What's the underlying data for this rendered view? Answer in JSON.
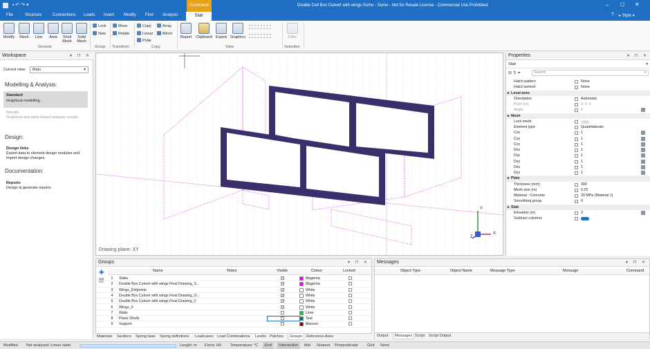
{
  "window": {
    "title": "Double Cell Box Culvert with wings.Sumo - Sumo - Not for Resale License - Commercial Use Prohibited",
    "context_tab": "Command",
    "style_label": "Style"
  },
  "menu": [
    "File",
    "Structure",
    "Connections",
    "Loads",
    "Insert",
    "Modify",
    "Find",
    "Analysis",
    "Slab"
  ],
  "ribbon": {
    "general": {
      "label": "General",
      "buttons": [
        "Modify",
        "Mesh",
        "Line",
        "Area",
        "Shell Mesh",
        "Solid Mesh"
      ]
    },
    "group": {
      "label": "Group",
      "buttons": [
        "Lock",
        "New"
      ]
    },
    "transform": {
      "label": "Transform",
      "buttons": [
        "Move",
        "Rotate"
      ]
    },
    "copy": {
      "label": "Copy",
      "buttons": [
        "Copy",
        "Array",
        "Linear",
        "Mirror",
        "Polar"
      ]
    },
    "view": {
      "label": "View",
      "buttons": [
        "Report",
        "Clipboard",
        "Export",
        "Graphics"
      ]
    },
    "selection": {
      "label": "Selection",
      "buttons": [
        "Filter"
      ]
    }
  },
  "workspace": {
    "title": "Workspace",
    "current_view_label": "Current view:",
    "current_view": "Main",
    "sections": [
      {
        "heading": "Modelling & Analysis:",
        "items": [
          {
            "title": "Standard",
            "desc": "Graphical modelling."
          },
          {
            "title": "Results",
            "desc": "Graphical and table-based analysis results."
          }
        ]
      },
      {
        "heading": "Design:",
        "items": [
          {
            "title": "Design links",
            "desc": "Export data to element design modules and import design changes."
          }
        ]
      },
      {
        "heading": "Documentation:",
        "items": [
          {
            "title": "Reports",
            "desc": "Design & generate reports."
          }
        ]
      }
    ]
  },
  "view": {
    "drawing_plane": "Drawing plane: XY",
    "axes": [
      "X",
      "Y",
      "Z"
    ]
  },
  "properties": {
    "title": "Properties",
    "selection": "Slab",
    "search_placeholder": "Search",
    "rows": [
      {
        "type": "row",
        "name": "Hatch pattern",
        "value": "None"
      },
      {
        "type": "row",
        "name": "Hatch behind",
        "value": "None"
      },
      {
        "type": "section",
        "name": "Local axes"
      },
      {
        "type": "row",
        "name": "Orientation",
        "value": "Automatic"
      },
      {
        "type": "row",
        "name": "Point (m)",
        "value": "0, 0, 0"
      },
      {
        "type": "row",
        "name": "Angle",
        "value": "0",
        "edit": true
      },
      {
        "type": "section",
        "name": "Mesh"
      },
      {
        "type": "row",
        "name": "Lock mesh",
        "value": ""
      },
      {
        "type": "row",
        "name": "Element type",
        "value": "Quadrilaterals"
      },
      {
        "type": "row",
        "name": "Cxx",
        "value": "1",
        "edit": true
      },
      {
        "type": "row",
        "name": "Cyy",
        "value": "1",
        "edit": true
      },
      {
        "type": "row",
        "name": "Cxy",
        "value": "1",
        "edit": true
      },
      {
        "type": "row",
        "name": "Dxx",
        "value": "1",
        "edit": true
      },
      {
        "type": "row",
        "name": "Dyy",
        "value": "1",
        "edit": true
      },
      {
        "type": "row",
        "name": "Dxy",
        "value": "1",
        "edit": true
      },
      {
        "type": "row",
        "name": "Dxz",
        "value": "1",
        "edit": true
      },
      {
        "type": "row",
        "name": "Dyz",
        "value": "1",
        "edit": true
      },
      {
        "type": "section",
        "name": "Plate"
      },
      {
        "type": "row",
        "name": "Thickness (mm)",
        "value": "300"
      },
      {
        "type": "row",
        "name": "Mesh size (m)",
        "value": "0.25"
      },
      {
        "type": "row",
        "name": "Material - Concrete",
        "value": "30 MPa (Material 1)"
      },
      {
        "type": "row",
        "name": "Smoothing group",
        "value": "0"
      },
      {
        "type": "section",
        "name": "Slab"
      },
      {
        "type": "row",
        "name": "Elevation (m)",
        "value": "3",
        "edit": true
      },
      {
        "type": "row",
        "name": "Subtract columns",
        "value": ""
      }
    ]
  },
  "groups": {
    "title": "Groups",
    "columns": [
      "Name",
      "Notes",
      "Visible",
      "Colour",
      "Locked"
    ],
    "rows": [
      {
        "num": "1",
        "name": "Slabs",
        "visible": true,
        "color_hex": "#d41cd4",
        "color": "Magenta"
      },
      {
        "num": "2",
        "name": "Double Box Culvert with wings Final Drawing_S...",
        "visible": true,
        "color_hex": "#d41cd4",
        "color": "Magenta"
      },
      {
        "num": "3",
        "name": "Wings_Dxfpoints",
        "visible": true,
        "color_hex": "#ffffff",
        "color": "White"
      },
      {
        "num": "4",
        "name": "Double Box Culvert with wings Final Drawing_O...",
        "visible": true,
        "color_hex": "#ffffff",
        "color": "White"
      },
      {
        "num": "5",
        "name": "Double Box Culvert with wings Final Drawing_0",
        "visible": true,
        "color_hex": "#ffffff",
        "color": "White"
      },
      {
        "num": "6",
        "name": "Wings_0",
        "visible": true,
        "color_hex": "#ffffff",
        "color": "White"
      },
      {
        "num": "7",
        "name": "Walls",
        "visible": false,
        "color_hex": "#22cc22",
        "color": "Lime"
      },
      {
        "num": "8",
        "name": "Plane Shells",
        "visible": false,
        "color_hex": "#0f6d6d",
        "color": "Teal"
      },
      {
        "num": "9",
        "name": "Support",
        "visible": false,
        "color_hex": "#7a0000",
        "color": "Maroon"
      }
    ]
  },
  "bottom_tabs": [
    "Materials",
    "Sections",
    "Spring laws",
    "Spring definitions",
    "Loadcases",
    "Load Combinations",
    "Levels",
    "Patches",
    "Groups",
    "Reference Axes"
  ],
  "messages": {
    "title": "Messages",
    "columns": [
      "Object Type",
      "Object Name",
      "Message Type",
      "Message",
      "Command"
    ],
    "tabs": [
      "Output",
      "Messages",
      "Script",
      "Script Output"
    ]
  },
  "status": {
    "mode": "Modified",
    "analysis": "Not analysed: Linear static",
    "length": "Length: m",
    "force": "Force: kN",
    "temperature": "Temperature: °C",
    "snaps": [
      "End",
      "Intersection",
      "Mid",
      "Nearest",
      "Perpendicular",
      "Grid",
      "None"
    ]
  }
}
